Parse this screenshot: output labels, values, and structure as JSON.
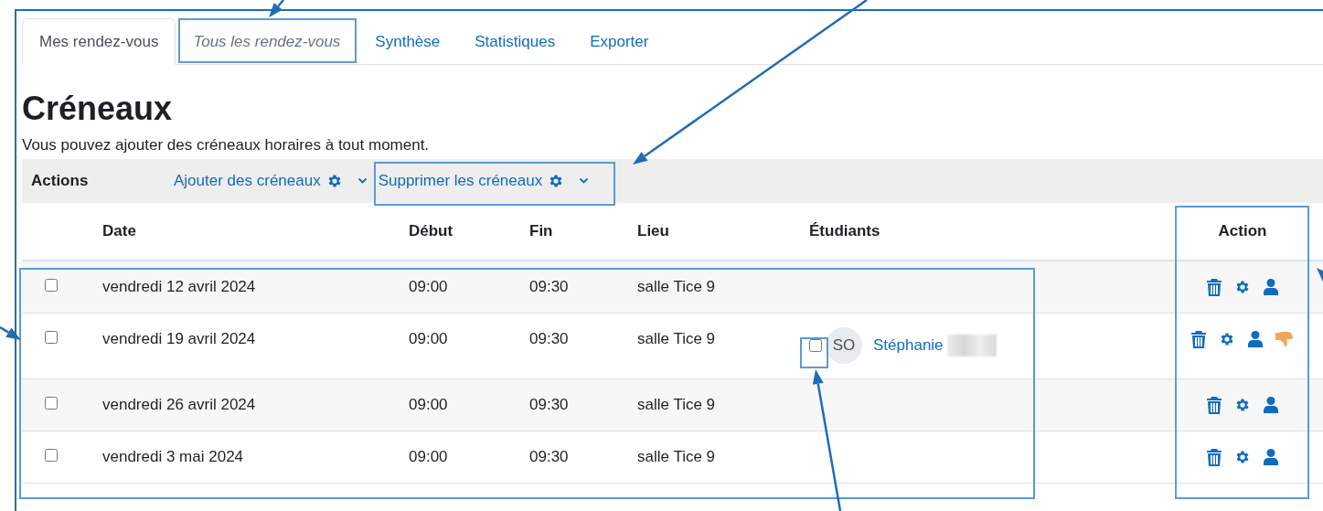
{
  "tabs": [
    {
      "label": "Mes rendez-vous",
      "selected": true,
      "disabled": false
    },
    {
      "label": "Tous les rendez-vous",
      "selected": false,
      "disabled": true
    },
    {
      "label": "Synthèse",
      "selected": false,
      "disabled": false
    },
    {
      "label": "Statistiques",
      "selected": false,
      "disabled": false
    },
    {
      "label": "Exporter",
      "selected": false,
      "disabled": false
    }
  ],
  "title": "Créneaux",
  "description": "Vous pouvez ajouter des créneaux horaires à tout moment.",
  "actions_bar": {
    "label": "Actions",
    "menus": [
      {
        "label": "Ajouter des créneaux"
      },
      {
        "label": "Supprimer les créneaux"
      }
    ]
  },
  "table": {
    "columns": [
      "Date",
      "Début",
      "Fin",
      "Lieu",
      "Étudiants",
      "Action"
    ],
    "rows": [
      {
        "checked": false,
        "date": "vendredi 12 avril 2024",
        "start": "09:00",
        "end": "09:30",
        "place": "salle Tice 9",
        "students": [],
        "thumbs_down": false
      },
      {
        "checked": false,
        "date": "vendredi 19 avril 2024",
        "start": "09:00",
        "end": "09:30",
        "place": "salle Tice 9",
        "students": [
          {
            "checked": false,
            "initials": "SO",
            "name": "Stéphanie",
            "surname_blurred": true
          }
        ],
        "thumbs_down": true
      },
      {
        "checked": false,
        "date": "vendredi 26 avril 2024",
        "start": "09:00",
        "end": "09:30",
        "place": "salle Tice 9",
        "students": [],
        "thumbs_down": false
      },
      {
        "checked": false,
        "date": "vendredi 3 mai 2024",
        "start": "09:00",
        "end": "09:30",
        "place": "salle Tice 9",
        "students": [],
        "thumbs_down": false
      }
    ]
  }
}
